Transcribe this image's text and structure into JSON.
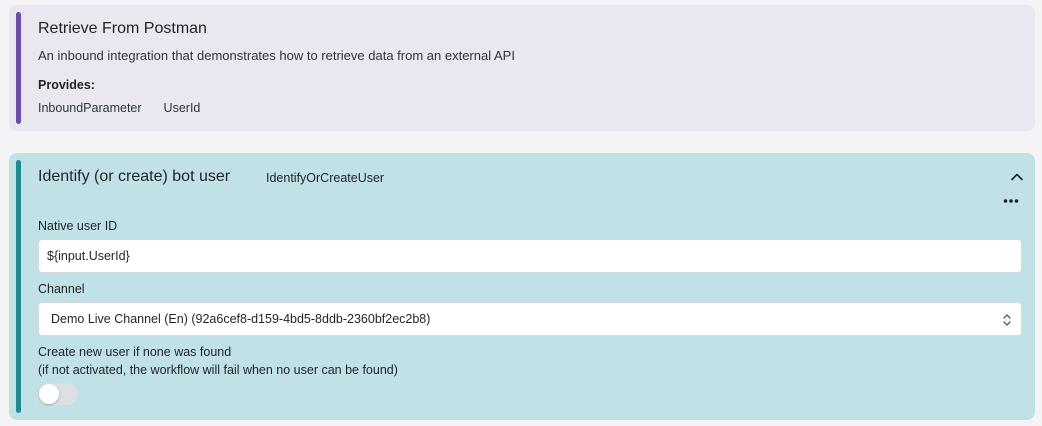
{
  "source": {
    "title": "Retrieve From Postman",
    "description": "An inbound integration that demonstrates how to retrieve data from an external API",
    "provides_label": "Provides:",
    "params": [
      "InboundParameter",
      "UserId"
    ]
  },
  "step": {
    "title": "Identify (or create) bot user",
    "type": "IdentifyOrCreateUser",
    "native_user_id": {
      "label": "Native user ID",
      "value": "${input.UserId}"
    },
    "channel": {
      "label": "Channel",
      "selected": "Demo Live Channel (En) (92a6cef8-d159-4bd5-8ddb-2360bf2ec2b8)"
    },
    "create_user": {
      "label": "Create new user if none was found",
      "hint": "(if not activated, the workflow will fail when no user can be found)",
      "enabled": false
    }
  },
  "colors": {
    "source_bg": "#ebe7f1",
    "source_accent": "#6a4ea5",
    "step_bg": "#c0e2e6",
    "step_accent": "#1f8b91"
  },
  "icons": {
    "collapse": "chevron-up-icon",
    "more": "more-horizontal-icon",
    "select": "chevron-updown-icon"
  }
}
